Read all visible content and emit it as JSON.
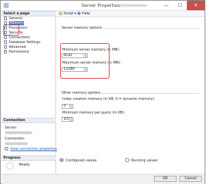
{
  "window": {
    "title": "Server Properties - ",
    "controls": {
      "minimize": "—",
      "maximize": "☐",
      "close": "✕"
    }
  },
  "left_pane": {
    "select_page_header": "Select a page",
    "pages": [
      "General",
      "Memory",
      "Processors",
      "Security",
      "Connections",
      "Database Settings",
      "Advanced",
      "Permissions"
    ],
    "selected_page": "Memory",
    "connection_header": "Connection",
    "server_label": "Server:",
    "connection_label": "Connection:",
    "view_connection_link": "View connection properties",
    "progress_header": "Progress",
    "progress_status": "Ready"
  },
  "toolbar": {
    "script_label": "Script",
    "help_label": "Help"
  },
  "server_memory": {
    "group_label": "Server memory options",
    "min_label": "Minimum server memory (in MB):",
    "min_value": "8192",
    "max_label": "Maximum server memory (in MB):",
    "max_value": "12288"
  },
  "other_memory": {
    "group_label": "Other memory options",
    "index_label": "Index creation memory (in KB, 0 = dynamic memory):",
    "index_value": "0",
    "min_query_label": "Minimum memory per query (in KB):",
    "min_query_value": "1024"
  },
  "values_mode": {
    "configured_label": "Configured values",
    "running_label": "Running values",
    "selected": "configured"
  },
  "buttons": {
    "ok": "OK",
    "cancel": "Cancel"
  },
  "colors": {
    "highlight_red": "#e0393e",
    "selected_blue": "#3c7fd0",
    "link_blue": "#1e5fb4"
  }
}
